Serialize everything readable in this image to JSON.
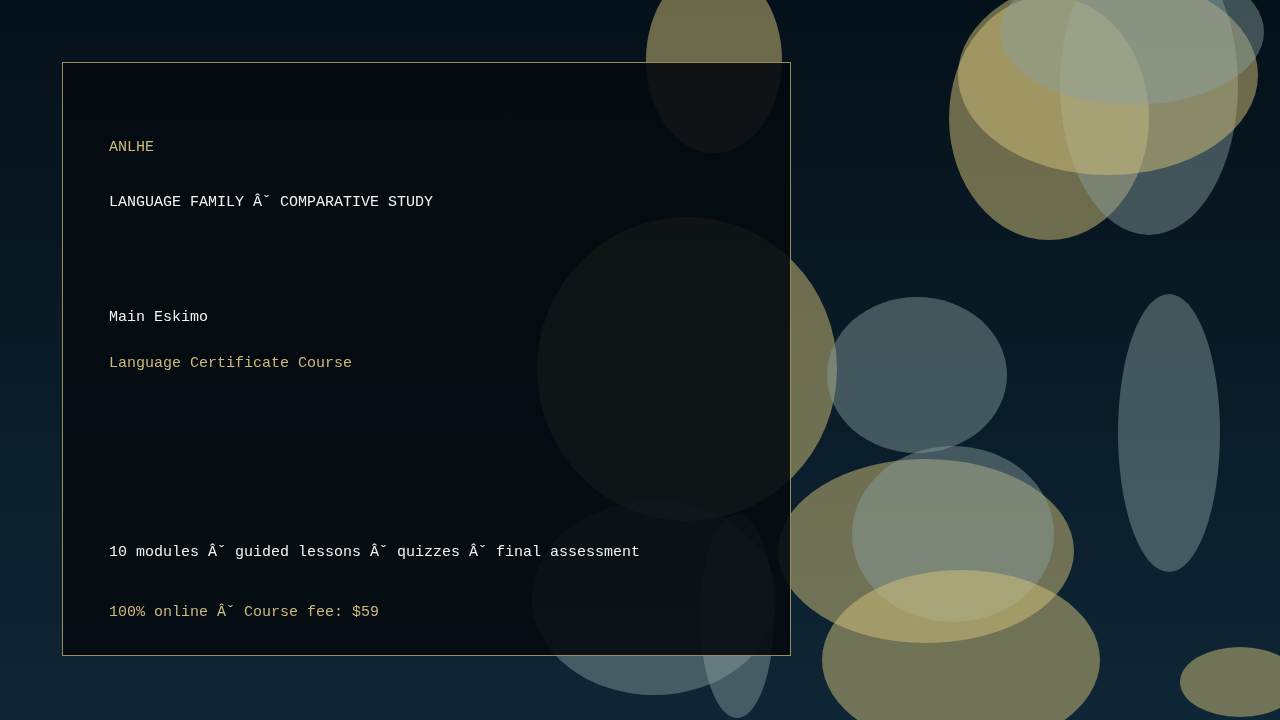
{
  "panel": {
    "brand": "ANLHE",
    "subtitle": "LANGUAGE FAMILY Âˇ COMPARATIVE STUDY",
    "title": "Main Eskimo",
    "course": "Language Certificate Course",
    "features": "10 modules Âˇ guided lessons Âˇ quizzes Âˇ final assessment",
    "pricing": "100% online Âˇ Course fee: $59"
  }
}
